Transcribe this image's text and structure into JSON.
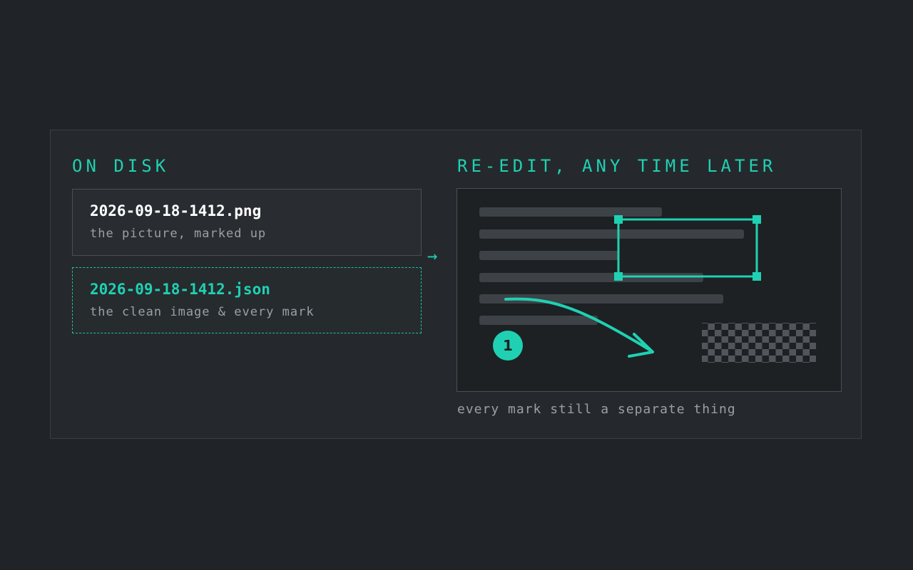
{
  "headings": {
    "on_disk": "ON DISK",
    "re_edit": "RE-EDIT, ANY TIME LATER"
  },
  "files": [
    {
      "name": "2026-09-18-1412.png",
      "description": "the picture, marked up"
    },
    {
      "name": "2026-09-18-1412.json",
      "description": "the clean image & every mark"
    }
  ],
  "flow_arrow": "→",
  "preview": {
    "step_badge": "1",
    "caption": "every mark still a separate thing"
  },
  "colors": {
    "accent": "#1fd1b2",
    "background": "#202428",
    "panel": "#25292d",
    "muted_text": "#9aa0a6"
  }
}
